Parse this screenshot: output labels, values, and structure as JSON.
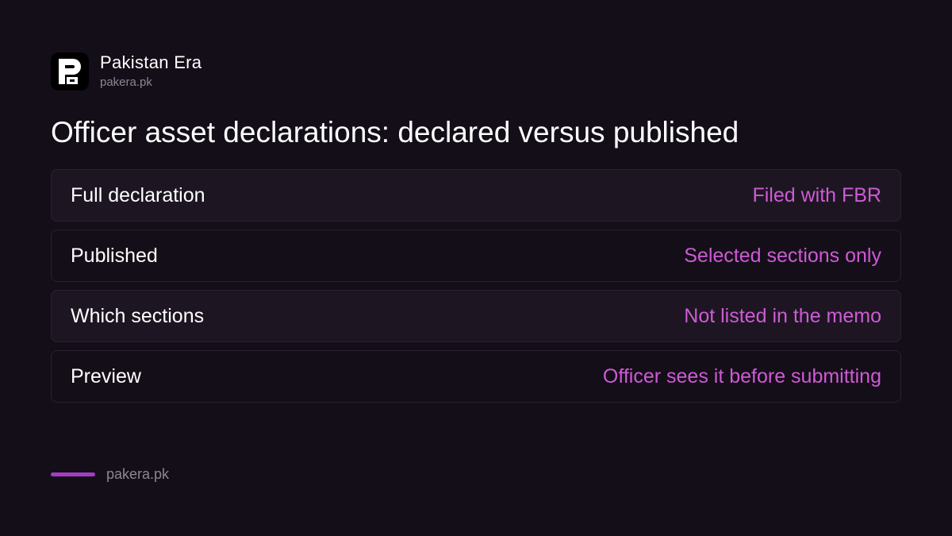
{
  "brand": {
    "name": "Pakistan Era",
    "url": "pakera.pk",
    "logo_icon": "pakera-logo-icon"
  },
  "title": "Officer asset declarations: declared versus published",
  "rows": [
    {
      "label": "Full declaration",
      "value": "Filed with FBR"
    },
    {
      "label": "Published",
      "value": "Selected sections only"
    },
    {
      "label": "Which sections",
      "value": "Not listed in the memo"
    },
    {
      "label": "Preview",
      "value": "Officer sees it before submitting"
    }
  ],
  "footer": {
    "url": "pakera.pk"
  },
  "colors": {
    "background": "#140e18",
    "accent": "#cf5ad6",
    "footer_bar": "#a43cc4",
    "muted": "#8d8594"
  }
}
